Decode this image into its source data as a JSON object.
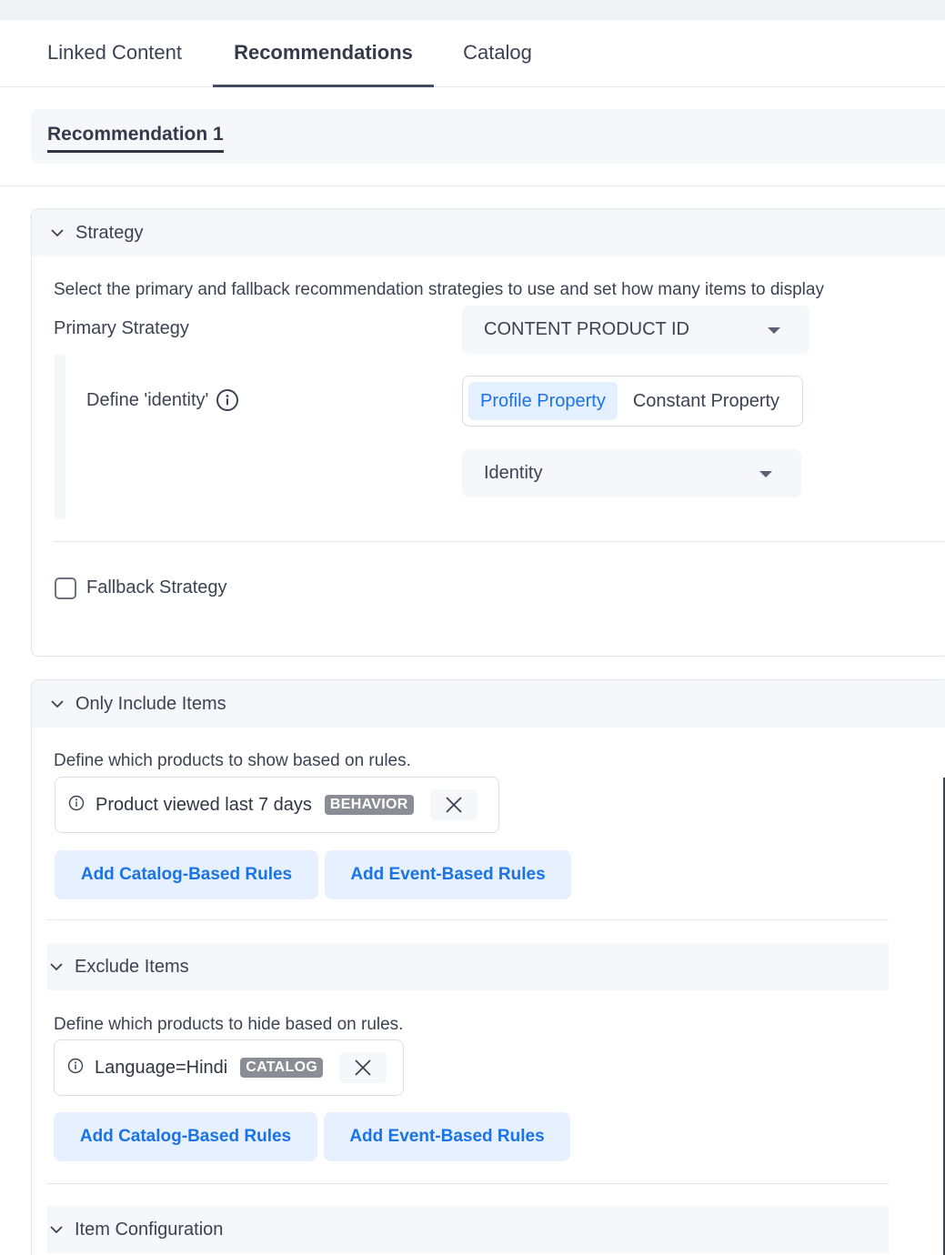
{
  "tabs": [
    {
      "label": "Linked Content"
    },
    {
      "label": "Recommendations",
      "active": true
    },
    {
      "label": "Catalog"
    }
  ],
  "recommendation_tab": {
    "label": "Recommendation 1"
  },
  "strategy": {
    "title": "Strategy",
    "description": "Select the primary and fallback recommendation strategies to use and set how many items to display",
    "primary_label": "Primary Strategy",
    "primary_value": "CONTENT PRODUCT ID",
    "identity_label": "Define 'identity'",
    "segment_options": [
      "Profile Property",
      "Constant Property"
    ],
    "segment_selected": "Profile Property",
    "identity_value": "Identity",
    "fallback_label": "Fallback Strategy",
    "fallback_checked": false
  },
  "include": {
    "title": "Only Include Items",
    "description": "Define which products to show based on rules.",
    "rule_text": "Product viewed last 7 days",
    "rule_badge": "BEHAVIOR",
    "catalog_button": "Add Catalog-Based Rules",
    "event_button": "Add Event-Based Rules"
  },
  "exclude": {
    "title": "Exclude Items",
    "description": "Define which products to hide based on rules.",
    "rule_text": "Language=Hindi",
    "rule_badge": "CATALOG",
    "catalog_button": "Add Catalog-Based Rules",
    "event_button": "Add Event-Based Rules"
  },
  "item_config": {
    "title": "Item Configuration"
  },
  "colors": {
    "accent": "#1a73e8",
    "accent_bg": "#e6f0fe",
    "panel_bg": "#f5f7fa",
    "badge": "#8a8d94"
  }
}
